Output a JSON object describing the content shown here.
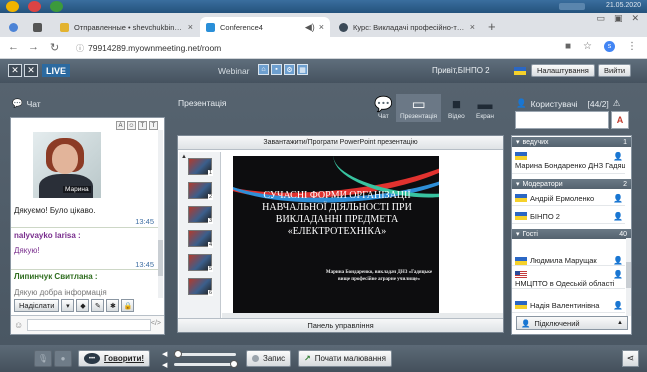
{
  "taskbar": {
    "date": "21.05.2020"
  },
  "browser": {
    "tabs": [
      {
        "label": "Отправленные • shevchukbinp...",
        "active": false
      },
      {
        "label": "Conference4",
        "active": true
      },
      {
        "label": "Курс: Викладачі професійно-те...",
        "active": false
      }
    ],
    "url": "79914289.myownmeeting.net/room",
    "profile_letter": "s"
  },
  "app": {
    "logo": "✕✕",
    "live_label": "LIVE",
    "webinar_label": "Webinar",
    "greeting": "Привіт,БІНПО 2",
    "settings_button": "Налаштування",
    "exit_button": "Вийти"
  },
  "chat": {
    "title": "Чат",
    "video_label": "Марина",
    "messages": [
      {
        "type": "text",
        "text": "Дякуємо! Було цікаво."
      },
      {
        "type": "time",
        "text": "13:45"
      },
      {
        "type": "name",
        "text": "nalyvayko larisa :"
      },
      {
        "type": "text",
        "text": "Дякую!"
      },
      {
        "type": "time",
        "text": "13:45"
      },
      {
        "type": "name",
        "text": "Липинчук Свитлана :"
      },
      {
        "type": "text",
        "text": "Дякую добра інформація"
      }
    ],
    "send_button": "Надіслати"
  },
  "presentation": {
    "title": "Презентація",
    "modes": [
      {
        "label": "Чат",
        "icon": "chat-bubble-icon"
      },
      {
        "label": "Презентація",
        "icon": "presentation-icon"
      },
      {
        "label": "Відео",
        "icon": "video-camera-icon"
      },
      {
        "label": "Екран",
        "icon": "screen-icon"
      }
    ],
    "upload_bar": "Завантажити/Програти PowerPoint презентацію",
    "control_panel": "Панель управління",
    "thumbnails": [
      "1",
      "2",
      "3",
      "4",
      "5",
      "6"
    ],
    "slide": {
      "title": "Сучасні форми організації навчальної діяльності при викладанні предмета «Електротехніка»",
      "subtitle": "Марина Бондаренко, викладач ДНЗ «Гадяцьке вище професійне аграрне училище»"
    }
  },
  "users": {
    "title": "Користувачі",
    "count": "[44/2]",
    "sort_label": "A",
    "groups": [
      {
        "name": "ведучих",
        "count": "1",
        "users": [
          {
            "name": "Марина Бондаренко ДНЗ Гадяц",
            "flag": "ua"
          }
        ]
      },
      {
        "name": "Модератори",
        "count": "2",
        "users": [
          {
            "name": "Андрій Ермоленко",
            "flag": "ua"
          },
          {
            "name": "БІНПО 2",
            "flag": "ua"
          }
        ]
      },
      {
        "name": "Гості",
        "count": "40",
        "users": [
          {
            "name": "Людмила Марущак",
            "flag": "ua"
          },
          {
            "name": "НМЦПТО в Одеській області",
            "flag": "us"
          },
          {
            "name": "Надія Валентинівна",
            "flag": "ua"
          }
        ]
      }
    ],
    "status": "Підключений"
  },
  "toolbar": {
    "speak_button": "Говорити!",
    "record_button": "Запис",
    "draw_button": "Почати малювання"
  },
  "colors": {
    "header_bg": "#4e5b68",
    "accent": "#2c6aa0"
  }
}
